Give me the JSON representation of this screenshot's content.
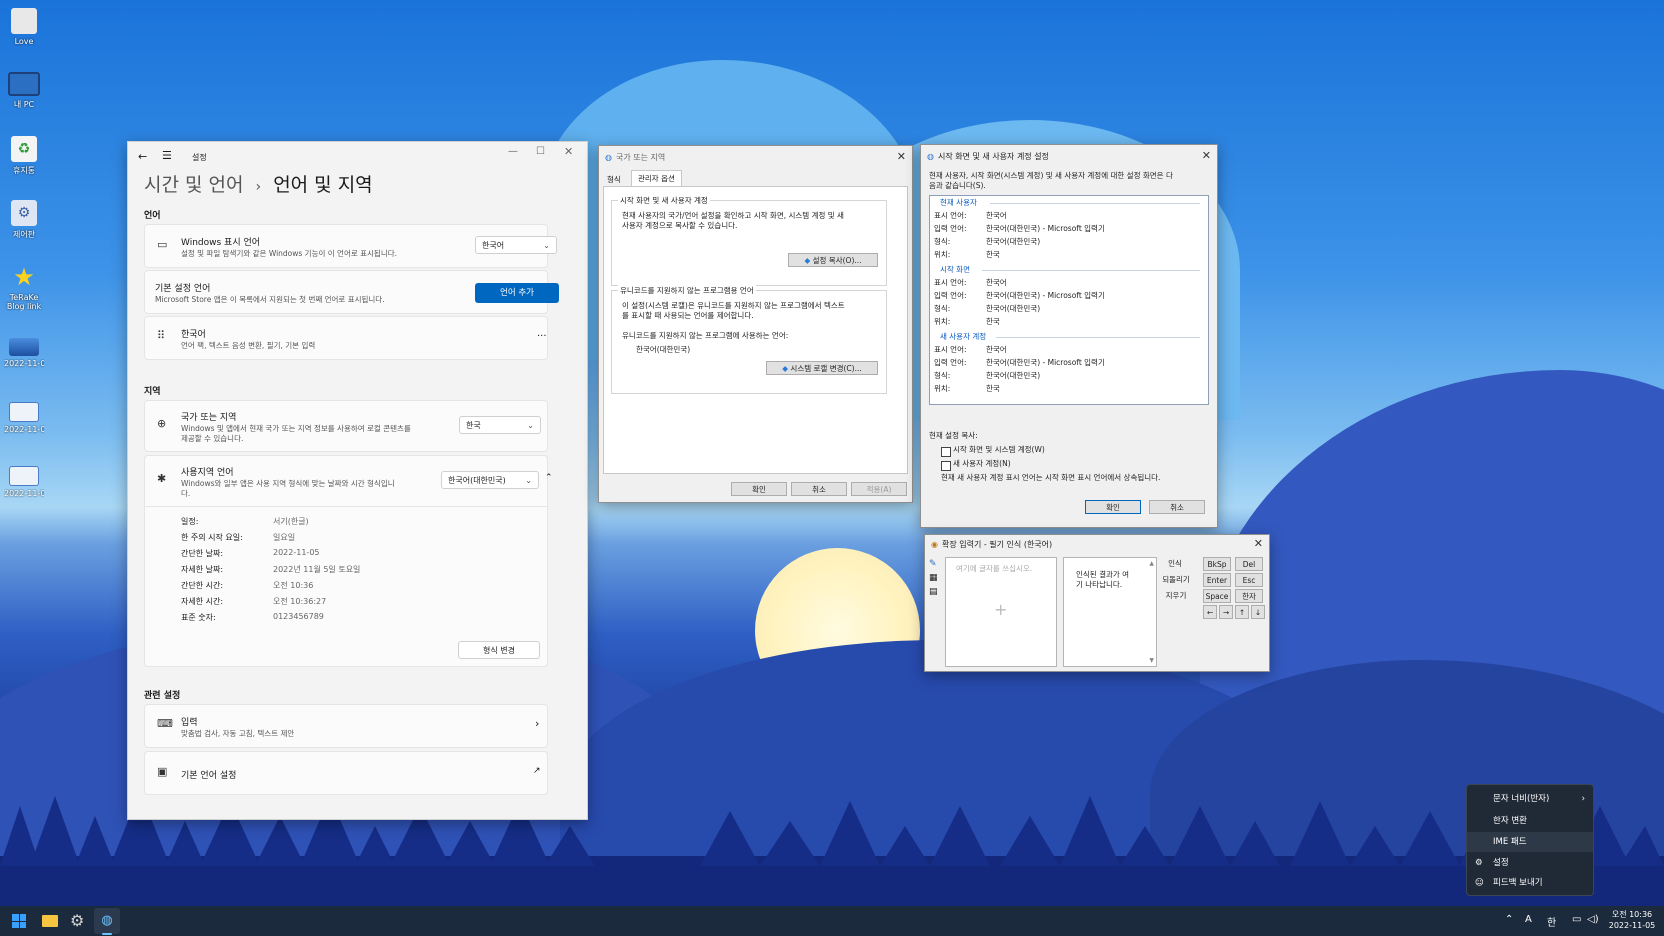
{
  "desktop": {
    "icons": [
      {
        "label": "Love",
        "icon": "user-folder-icon"
      },
      {
        "label": "내 PC",
        "icon": "computer-icon"
      },
      {
        "label": "휴지통",
        "icon": "recycle-bin-icon"
      },
      {
        "label": "제어판",
        "icon": "control-panel-icon"
      },
      {
        "label": "TeRaKe Blog link",
        "icon": "star-icon"
      },
      {
        "label": "2022-11-0...",
        "icon": "image-file-icon"
      },
      {
        "label": "2022-11-0...",
        "icon": "image-file-icon"
      },
      {
        "label": "2022-11-0...",
        "icon": "image-file-icon"
      }
    ]
  },
  "settings": {
    "app_title": "설정",
    "breadcrumb_parent": "시간 및 언어",
    "breadcrumb_sep": "›",
    "page_title": "언어 및 지역",
    "lang_section": "언어",
    "display_lang_title": "Windows 표시 언어",
    "display_lang_sub": "설정 및 파일 탐색기와 같은 Windows 기능이 이 언어로 표시됩니다.",
    "display_lang_value": "한국어",
    "pref_lang_title": "기본 설정 언어",
    "pref_lang_sub": "Microsoft Store 앱은 이 목록에서 지원되는 첫 번째 언어로 표시됩니다.",
    "add_lang_button": "언어 추가",
    "korean_title": "한국어",
    "korean_sub": "언어 팩, 텍스트 음성 변환, 필기, 기본 입력",
    "more_glyph": "···",
    "region_section": "지역",
    "country_title": "국가 또는 지역",
    "country_sub1": "Windows 및 앱에서 현재 국가 또는 지역 정보를 사용하여 로컬 콘텐츠를",
    "country_sub2": "제공할 수 있습니다.",
    "country_value": "한국",
    "format_title": "사용지역 언어",
    "format_sub1": "Windows와 일부 앱은 사용 지역 형식에 맞는 날짜와 시간 형식입니",
    "format_sub2": "다.",
    "format_value": "한국어(대한민국)",
    "format_rows": [
      {
        "k": "일정:",
        "v": "서기(한글)"
      },
      {
        "k": "한 주의 시작 요일:",
        "v": "일요일"
      },
      {
        "k": "간단한 날짜:",
        "v": "2022-11-05"
      },
      {
        "k": "자세한 날짜:",
        "v": "2022년 11월 5일 토요일"
      },
      {
        "k": "간단한 시간:",
        "v": "오전 10:36"
      },
      {
        "k": "자세한 시간:",
        "v": "오전 10:36:27"
      },
      {
        "k": "표준 숫자:",
        "v": "0123456789"
      }
    ],
    "change_format_button": "형식 변경",
    "related_section": "관련 설정",
    "input_title": "입력",
    "input_sub": "맞춤법 검사, 자동 고침, 텍스트 제안",
    "admin_lang_title": "기본 언어 설정"
  },
  "region_dialog": {
    "title": "국가 또는 지역",
    "tab_format": "형식",
    "tab_admin": "관리자 옵션",
    "grp1_title": "시작 화면 및 새 사용자 계정",
    "grp1_text1": "현재 사용자의 국가/언어 설정을 확인하고 시작 화면, 시스템 계정 및 새",
    "grp1_text2": "사용자 계정으로 복사할 수 있습니다.",
    "copy_settings_button": "설정 복사(O)...",
    "grp2_title": "유니코드를 지원하지 않는 프로그램용 언어",
    "grp2_text1": "이 설정(시스템 로캘)은 유니코드를 지원하지 않는 프로그램에서 텍스트",
    "grp2_text2": "를 표시할 때 사용되는 언어를 제어합니다.",
    "grp2_text3": "유니코드를 지원하지 않는 프로그램에 사용하는 언어:",
    "current_locale": "한국어(대한민국)",
    "change_locale_button": "시스템 로캘 변경(C)...",
    "ok": "확인",
    "cancel": "취소",
    "apply": "적용(A)"
  },
  "copy_dialog": {
    "title": "시작 화면 및 새 사용자 계정 설정",
    "intro1": "현재 사용자, 시작 화면(시스템 계정) 및 새 사용자 계정에 대한 설정 화면은 다",
    "intro2": "음과 같습니다(S).",
    "sections": [
      {
        "name": "현재 사용자",
        "rows": [
          {
            "k": "표시 언어:",
            "v": "한국어"
          },
          {
            "k": "입력 언어:",
            "v": "한국어(대한민국) - Microsoft 입력기"
          },
          {
            "k": "형식:",
            "v": "한국어(대한민국)"
          },
          {
            "k": "위치:",
            "v": "한국"
          }
        ]
      },
      {
        "name": "시작 화면",
        "rows": [
          {
            "k": "표시 언어:",
            "v": "한국어"
          },
          {
            "k": "입력 언어:",
            "v": "한국어(대한민국) - Microsoft 입력기"
          },
          {
            "k": "형식:",
            "v": "한국어(대한민국)"
          },
          {
            "k": "위치:",
            "v": "한국"
          }
        ]
      },
      {
        "name": "새 사용자 계정",
        "rows": [
          {
            "k": "표시 언어:",
            "v": "한국어"
          },
          {
            "k": "입력 언어:",
            "v": "한국어(대한민국) - Microsoft 입력기"
          },
          {
            "k": "형식:",
            "v": "한국어(대한민국)"
          },
          {
            "k": "위치:",
            "v": "한국"
          }
        ]
      }
    ],
    "copy_label": "현재 설정 복사:",
    "chk_welcome": "시작 화면 및 시스템 계정(W)",
    "chk_newuser": "새 사용자 계정(N)",
    "note": "현재 새 사용자 계정 표시 언어는 시작 화면 표시 언어에서 상속됩니다.",
    "ok": "확인",
    "cancel": "취소"
  },
  "ime_pad": {
    "title": "확장 입력기 - 필기 인식 (한국어)",
    "draw_hint": "여기에 글자를 쓰십시오.",
    "result_hint1": "인식된 결과가 여",
    "result_hint2": "기 나타납니다.",
    "btn_recognize": "인식",
    "btn_undo": "되돌리기",
    "btn_clear": "지우기",
    "keys": [
      "BkSp",
      "Del",
      "Enter",
      "Esc",
      "Space",
      "한자"
    ],
    "arrows": [
      "←",
      "→",
      "↑",
      "↓"
    ]
  },
  "context_menu": {
    "items": [
      "문자 너비(반자)",
      "한자 변환",
      "IME 패드",
      "설정",
      "피드백 보내기"
    ]
  },
  "taskbar": {
    "ime_a": "A",
    "ime_han": "한",
    "time": "오전 10:36",
    "date": "2022-11-05"
  }
}
